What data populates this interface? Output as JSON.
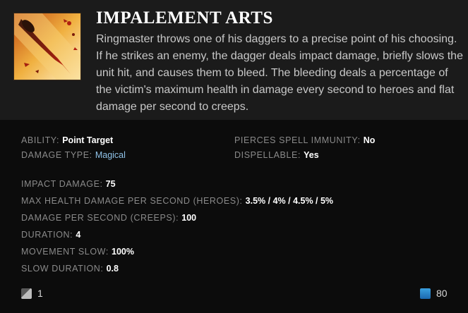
{
  "ability": {
    "title": "IMPALEMENT ARTS",
    "description": "Ringmaster throws one of his daggers to a precise point of his choosing. If he strikes an enemy, the dagger deals impact damage, briefly slows the unit hit, and causes them to bleed. The bleeding deals a percentage of the victim's maximum health in damage every second to heroes and flat damage per second to creeps.",
    "icon": "dagger-icon"
  },
  "properties": {
    "ability_label": "ABILITY:",
    "ability_value": "Point Target",
    "damage_type_label": "DAMAGE TYPE:",
    "damage_type_value": "Magical",
    "pierces_label": "PIERCES SPELL IMMUNITY:",
    "pierces_value": "No",
    "dispellable_label": "DISPELLABLE:",
    "dispellable_value": "Yes"
  },
  "stats": [
    {
      "label": "IMPACT DAMAGE:",
      "value": "75"
    },
    {
      "label": "MAX HEALTH DAMAGE PER SECOND (HEROES):",
      "value": "3.5% / 4% / 4.5% / 5%"
    },
    {
      "label": "DAMAGE PER SECOND (CREEPS):",
      "value": "100"
    },
    {
      "label": "DURATION:",
      "value": "4"
    },
    {
      "label": "MOVEMENT SLOW:",
      "value": "100%"
    },
    {
      "label": "SLOW DURATION:",
      "value": "0.8"
    }
  ],
  "footer": {
    "cooldown": "1",
    "mana": "80",
    "cooldown_icon": "cooldown-icon",
    "mana_icon": "mana-icon"
  },
  "colors": {
    "magical": "#8fc2e8",
    "header_bg": "#1b1b1b",
    "body_bg": "#0c0c0c"
  }
}
